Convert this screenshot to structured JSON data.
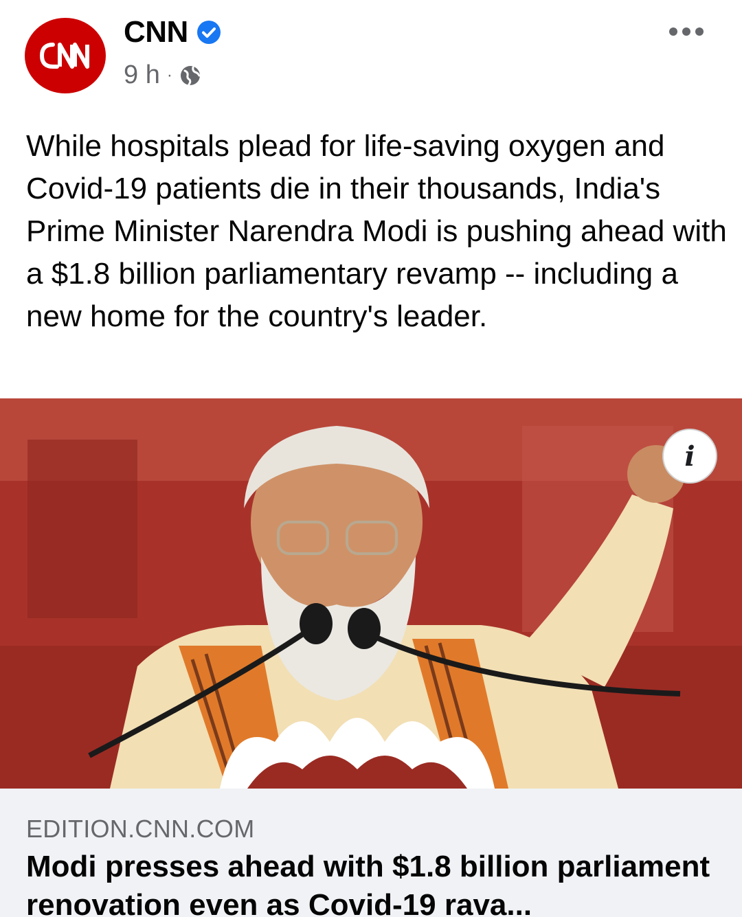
{
  "post": {
    "page_name": "CNN",
    "verified": true,
    "timestamp": "9 h",
    "separator": "·",
    "privacy_icon": "globe-icon",
    "avatar_logo": "CNN",
    "text": "While hospitals plead for life-saving oxygen and Covid-19 patients die in their thousands, India's Prime Minister Narendra Modi is pushing ahead with a $1.8 billion parliamentary revamp -- including a new home for the country's leader."
  },
  "media": {
    "info_label": "i"
  },
  "link_preview": {
    "domain": "EDITION.CNN.COM",
    "headline": "Modi presses ahead with $1.8 billion parliament renovation even as Covid-19 rava..."
  },
  "colors": {
    "brand": "#cc0000",
    "verified": "#1877f2",
    "secondary_text": "#65676b",
    "preview_bg": "#f0f2f5"
  }
}
